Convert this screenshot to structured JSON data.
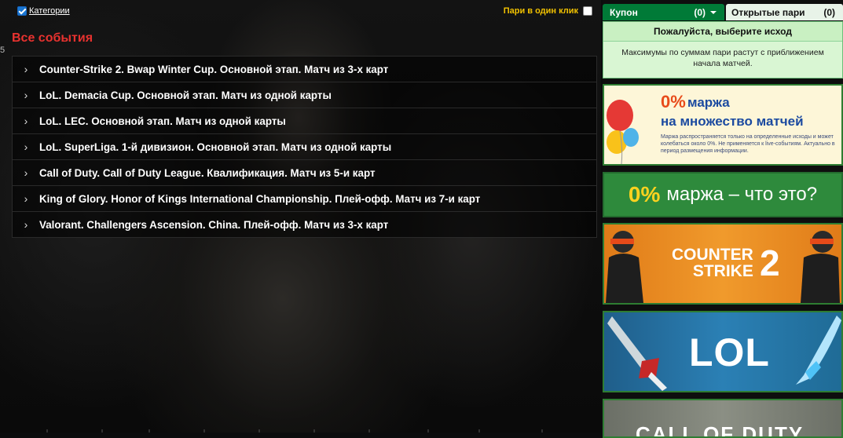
{
  "topbar": {
    "categories_label": "Категории",
    "categories_checked": true,
    "one_click_label": "Пари в один клик",
    "one_click_checked": false
  },
  "edge_mark": "5",
  "page_title": "Все события",
  "events": [
    {
      "label": "Counter-Strike 2. Bwap Winter Cup. Основной этап. Матч из 3-х карт"
    },
    {
      "label": "LoL. Demacia Cup. Основной этап. Матч из одной карты"
    },
    {
      "label": "LoL. LEC. Основной этап. Матч из одной карты"
    },
    {
      "label": "LoL. SuperLiga. 1-й дивизион. Основной этап. Матч из одной карты"
    },
    {
      "label": "Call of Duty. Call of Duty League. Квалификация. Матч из 5-и карт"
    },
    {
      "label": "King of Glory. Honor of Kings International Championship. Плей-офф. Матч из 7-и карт"
    },
    {
      "label": "Valorant. Challengers Ascension. China. Плей-офф. Матч из 3-х карт"
    }
  ],
  "coupon": {
    "tab_label": "Купон",
    "tab_count": "(0)",
    "open_bets_label": "Открытые пари",
    "open_bets_count": "(0)",
    "prompt": "Пожалуйста, выберите исход",
    "info": "Максимумы по суммам пари растут с приближением начала матчей."
  },
  "banners": {
    "margin": {
      "pct": "0%",
      "line1": "маржа",
      "line2": "на множество матчей",
      "small": "Маржа распространяется только на определенные исходы и может колебаться около 0%. Не применяется к live-событиям. Актуально в период размещения информации."
    },
    "what": {
      "pct": "0%",
      "text": "маржа – что это?"
    },
    "cs": {
      "title_line1": "COUNTER",
      "title_line2": "STRIKE",
      "number": "2"
    },
    "lol": {
      "title": "LOL"
    },
    "cod": {
      "title": "CALL OF DUTY"
    }
  },
  "colors": {
    "title_red": "#e8322f",
    "one_click_yellow": "#f2c200",
    "coupon_green": "#007a37",
    "coupon_bg": "#d9f6d3"
  }
}
